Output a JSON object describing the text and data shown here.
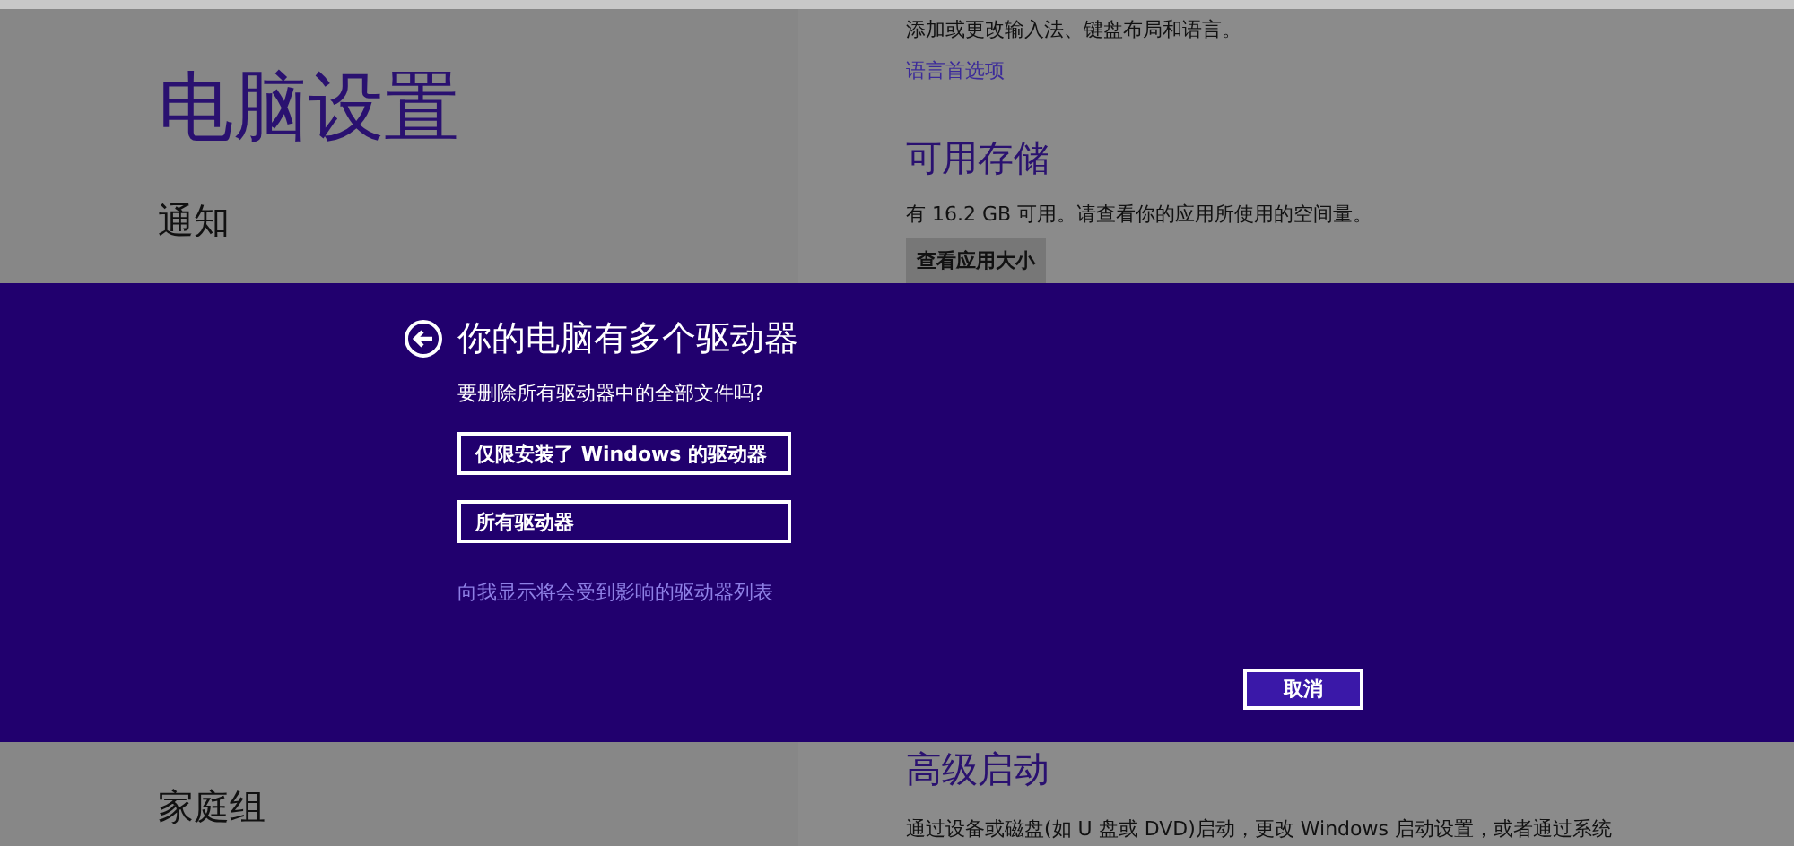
{
  "page": {
    "title": "电脑设置",
    "nav_items": [
      {
        "label": "通知"
      },
      {
        "label": "家庭组"
      }
    ],
    "top_description": "添加或更改输入法、键盘布局和语言。",
    "top_link": "语言首选项",
    "storage": {
      "heading": "可用存储",
      "description": "有 16.2 GB 可用。请查看你的应用所使用的空间量。",
      "button": "查看应用大小"
    },
    "advanced_startup": {
      "heading": "高级启动",
      "description": "通过设备或磁盘(如 U 盘或 DVD)启动，更改 Windows 启动设置，或者通过系统"
    }
  },
  "dialog": {
    "title": "你的电脑有多个驱动器",
    "question": "要删除所有驱动器中的全部文件吗?",
    "options": [
      {
        "label": "仅限安装了 Windows 的驱动器"
      },
      {
        "label": "所有驱动器"
      }
    ],
    "link": "向我显示将会受到影响的驱动器列表",
    "cancel": "取消"
  }
}
